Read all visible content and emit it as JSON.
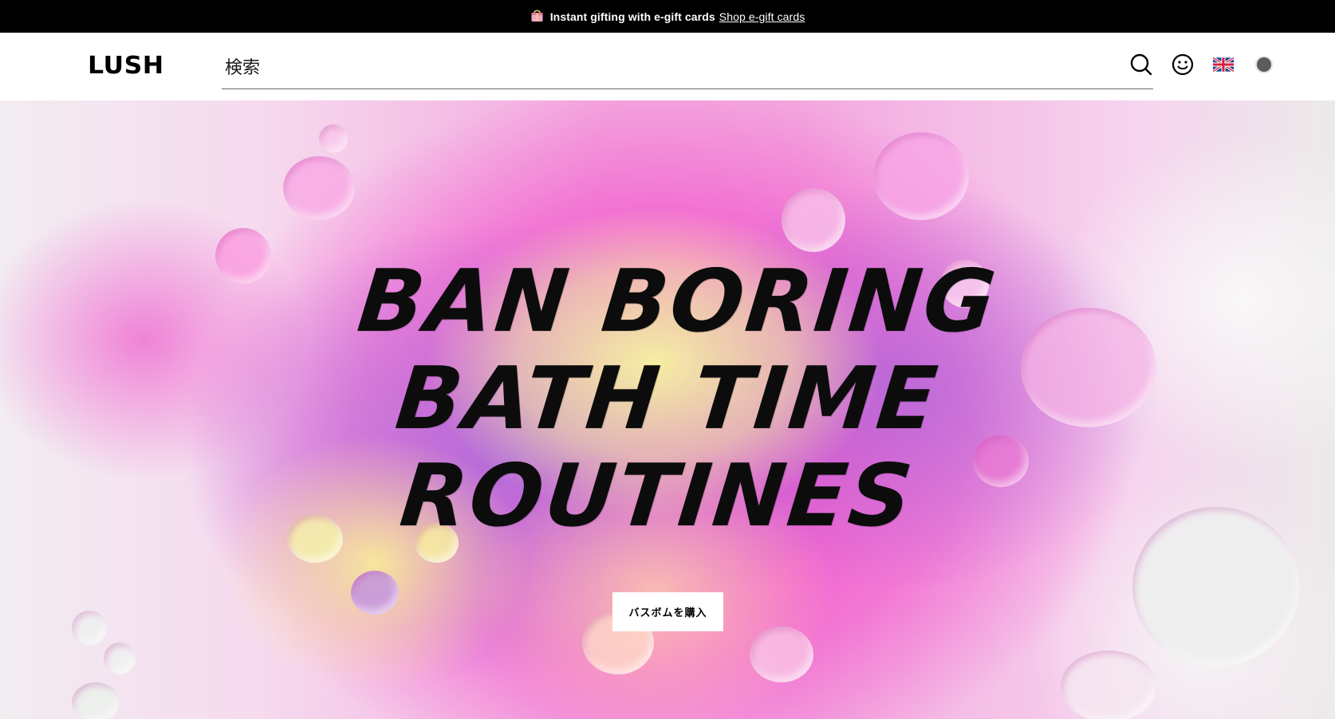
{
  "promo": {
    "icon": "gift-bag-icon",
    "text": "Instant gifting with e-gift cards",
    "link_label": "Shop e-gift cards"
  },
  "header": {
    "logo": "LUSH",
    "search_placeholder": "検索",
    "icons": {
      "search": "search-icon",
      "account": "smiley-account-icon",
      "language": "uk-flag-icon",
      "cart": "cart-dot-icon"
    }
  },
  "hero": {
    "title_lines": [
      "BAN BORING",
      "BATH TIME",
      "ROUTINES"
    ],
    "cta_label": "バスボムを購入"
  },
  "colors": {
    "promo_background": "#000000",
    "header_background": "#ffffff",
    "hero_pink": "#f246c8",
    "hero_yellow": "#f7f6a0",
    "hero_purple": "#a86edc",
    "cart_dot": "#5c5c5c"
  }
}
